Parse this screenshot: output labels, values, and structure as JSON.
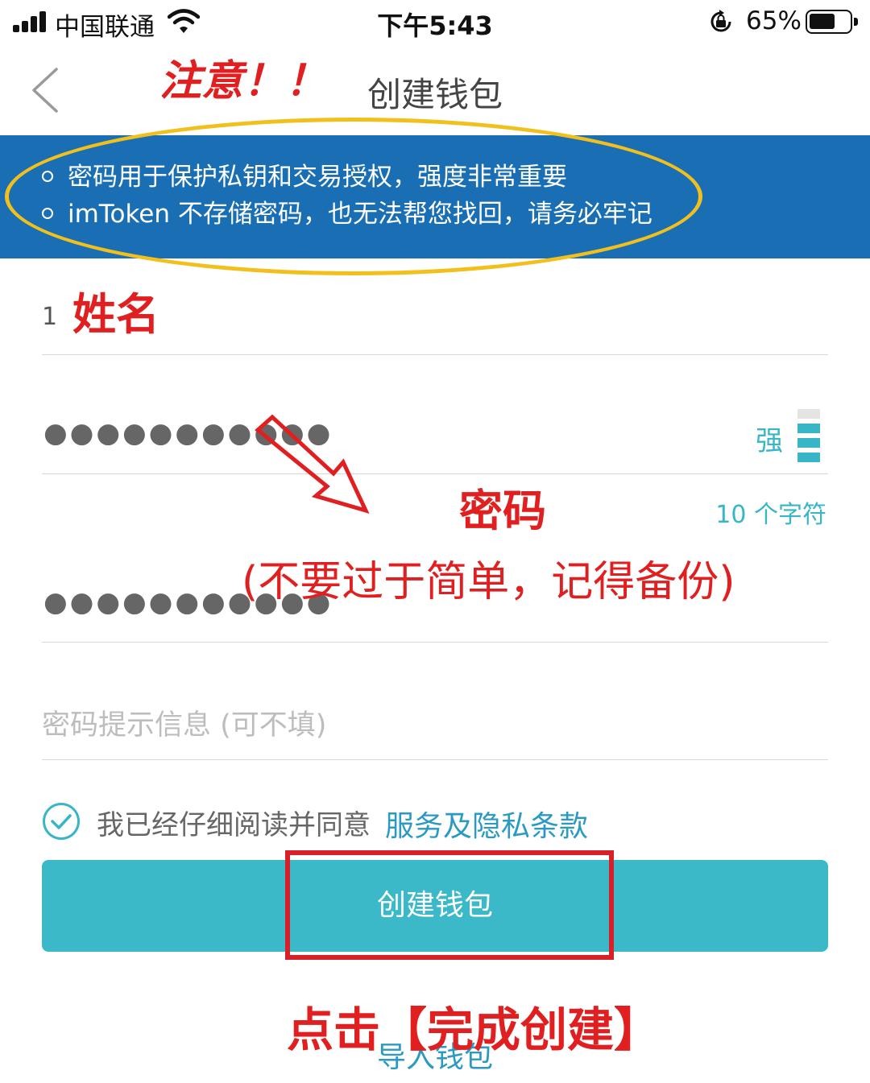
{
  "status_bar": {
    "carrier": "中国联通",
    "time": "下午5:43",
    "battery_percent": "65%",
    "battery_level": 0.65
  },
  "nav": {
    "title": "创建钱包",
    "back_icon": "chevron-left-icon"
  },
  "warning_banner": {
    "color": "#1a6fb4",
    "items": [
      "密码用于保护私钥和交易授权，强度非常重要",
      "imToken 不存储密码，也无法帮您找回，请务必牢记"
    ]
  },
  "form": {
    "wallet_name_value": "1",
    "password_mask": "●●●●●●●●●●●",
    "password_strength_label": "强",
    "password_strength_level": 3,
    "password_char_count": "10 个字符",
    "confirm_password_mask": "●●●●●●●●●●●",
    "hint_placeholder": "密码提示信息 (可不填)"
  },
  "agreement": {
    "checked": true,
    "text": "我已经仔细阅读并同意",
    "link": "服务及隐私条款"
  },
  "buttons": {
    "create_label": "创建钱包",
    "create_color": "#3bb9c9",
    "import_label": "导入钱包"
  },
  "annotations": {
    "attention": "注意！！",
    "name": "姓名",
    "password": "密码",
    "password_note": "(不要过于简单，记得备份)",
    "tap_instruction": "点击【完成创建】"
  }
}
